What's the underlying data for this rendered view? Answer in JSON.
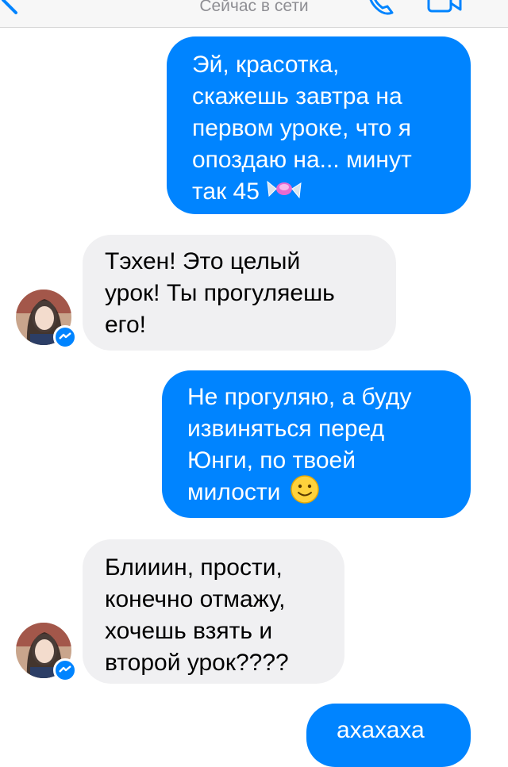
{
  "header": {
    "status": "Сейчас в сети",
    "back_icon": "chevron-left-icon",
    "call_icon": "phone-icon",
    "video_icon": "video-camera-icon"
  },
  "colors": {
    "outgoing_bubble": "#0084ff",
    "incoming_bubble": "#f0f0f2",
    "header_bg": "#f7f7f7",
    "accent": "#0084ff"
  },
  "messages": [
    {
      "direction": "out",
      "text": "Эй, красотка,\nскажешь завтра на\nпервом уроке, что я\nопоздаю на... минут\nтак 45",
      "emoji": "candy-icon"
    },
    {
      "direction": "in",
      "text": "Тэхен! Это целый\nурок! Ты прогуляешь\nего!"
    },
    {
      "direction": "out",
      "text": "Не прогуляю, а буду\nизвиняться перед\nЮнги, по твоей\nмилости",
      "emoji": "smiley-icon"
    },
    {
      "direction": "in",
      "text": "Блииин, прости,\nконечно отмажу,\nхочешь взять и\nвторой урок????"
    },
    {
      "direction": "out",
      "text": "ахахаха"
    }
  ]
}
